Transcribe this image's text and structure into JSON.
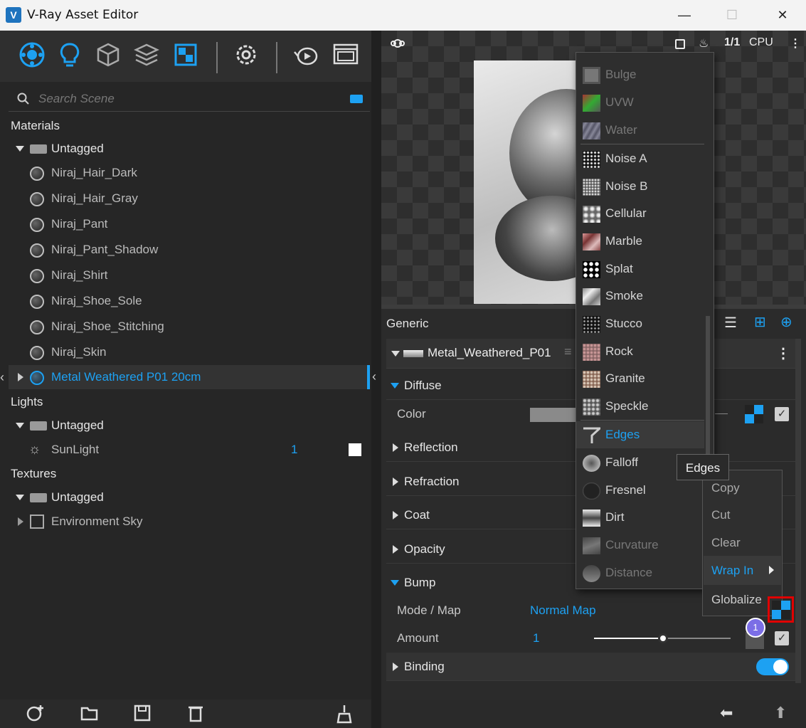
{
  "window": {
    "title": "V-Ray Asset Editor",
    "min": "—",
    "max": "☐",
    "close": "✕"
  },
  "search": {
    "placeholder": "Search Scene"
  },
  "tree": {
    "materials_label": "Materials",
    "materials_tag": "Untagged",
    "materials": [
      "Niraj_Hair_Dark",
      "Niraj_Hair_Gray",
      "Niraj_Pant",
      "Niraj_Pant_Shadow",
      "Niraj_Shirt",
      "Niraj_Shoe_Sole",
      "Niraj_Shoe_Stitching",
      "Niraj_Skin"
    ],
    "selected_material": "Metal Weathered P01 20cm",
    "lights_label": "Lights",
    "lights_tag": "Untagged",
    "light_name": "SunLight",
    "light_count": "1",
    "textures_label": "Textures",
    "textures_tag": "Untagged",
    "texture_name": "Environment Sky"
  },
  "viewport": {
    "ratio": "1/1",
    "engine": "CPU"
  },
  "panel": {
    "generic": "Generic",
    "material_name": "Metal_Weathered_P01",
    "diffuse": "Diffuse",
    "color_label": "Color",
    "reflection": "Reflection",
    "refraction": "Refraction",
    "coat": "Coat",
    "opacity": "Opacity",
    "bump": "Bump",
    "mode_map_label": "Mode / Map",
    "mode_map_value": "Normal Map",
    "amount_label": "Amount",
    "amount_value": "1",
    "binding": "Binding",
    "badge": "1"
  },
  "dropdown": {
    "items": [
      "Bulge",
      "UVW",
      "Water",
      "Noise A",
      "Noise B",
      "Cellular",
      "Marble",
      "Splat",
      "Smoke",
      "Stucco",
      "Rock",
      "Granite",
      "Speckle",
      "Edges",
      "Falloff",
      "Fresnel",
      "Dirt",
      "Curvature",
      "Distance"
    ],
    "highlighted": "Edges"
  },
  "tooltip": "Edges",
  "context_menu": {
    "copy": "Copy",
    "cut": "Cut",
    "clear": "Clear",
    "wrap_in": "Wrap In",
    "globalize": "Globalize"
  },
  "colors": {
    "accent": "#1da1f2",
    "highlight_box": "#e00000"
  }
}
